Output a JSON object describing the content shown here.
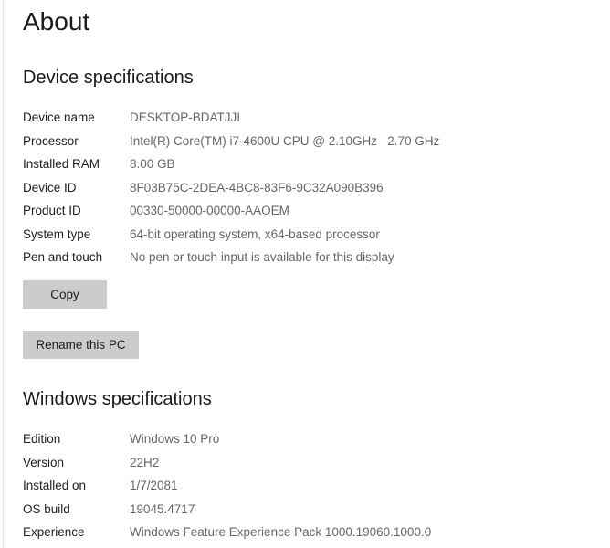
{
  "page": {
    "title": "About"
  },
  "device_specs": {
    "heading": "Device specifications",
    "rows": [
      {
        "label": "Device name",
        "value": "DESKTOP-BDATJJI"
      },
      {
        "label": "Processor",
        "value": "Intel(R) Core(TM) i7-4600U CPU @ 2.10GHz   2.70 GHz"
      },
      {
        "label": "Installed RAM",
        "value": "8.00 GB"
      },
      {
        "label": "Device ID",
        "value": "8F03B75C-2DEA-4BC8-83F6-9C32A090B396"
      },
      {
        "label": "Product ID",
        "value": "00330-50000-00000-AAOEM"
      },
      {
        "label": "System type",
        "value": "64-bit operating system, x64-based processor"
      },
      {
        "label": "Pen and touch",
        "value": "No pen or touch input is available for this display"
      }
    ],
    "copy_button": "Copy",
    "rename_button": "Rename this PC"
  },
  "windows_specs": {
    "heading": "Windows specifications",
    "rows": [
      {
        "label": "Edition",
        "value": "Windows 10 Pro"
      },
      {
        "label": "Version",
        "value": "22H2"
      },
      {
        "label": "Installed on",
        "value": "1/7/2081"
      },
      {
        "label": "OS build",
        "value": "19045.4717"
      },
      {
        "label": "Experience",
        "value": "Windows Feature Experience Pack 1000.19060.1000.0"
      }
    ]
  }
}
